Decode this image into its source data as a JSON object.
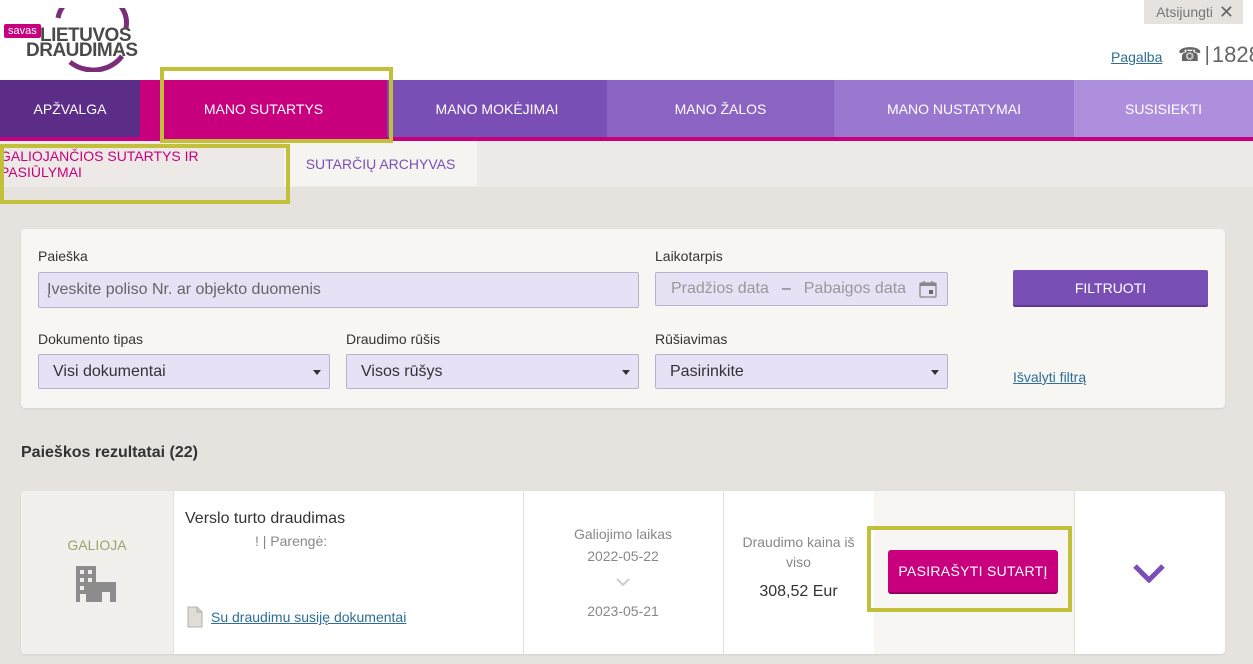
{
  "header": {
    "logo_badge": "savas",
    "logo_line1": "LIETUVOS",
    "logo_line2": "DRAUDIMAS",
    "logout_label": "Atsijungti",
    "help_label": "Pagalba",
    "phone": "1828"
  },
  "nav": {
    "items": [
      {
        "label": "APŽVALGA",
        "color": "#5c2d87"
      },
      {
        "label": "MANO SUTARTYS",
        "color": "#c8007e",
        "active": true
      },
      {
        "label": "MANO MOKĖJIMAI",
        "color": "#7a4fb5"
      },
      {
        "label": "MANO ŽALOS",
        "color": "#8b63c3"
      },
      {
        "label": "MANO NUSTATYMAI",
        "color": "#9a78d0"
      },
      {
        "label": "SUSISIEKTI",
        "color": "#ae8fdd"
      }
    ]
  },
  "subnav": {
    "active": "GALIOJANČIOS SUTARTYS IR PASIŪLYMAI",
    "archive": "SUTARČIŲ ARCHYVAS"
  },
  "filters": {
    "search_label": "Paieška",
    "search_placeholder": "Įveskite poliso Nr. ar objekto duomenis",
    "period_label": "Laikotarpis",
    "period_from": "Pradžios data",
    "period_dash": "–",
    "period_to": "Pabaigos data",
    "filter_button": "FILTRUOTI",
    "doc_type_label": "Dokumento tipas",
    "doc_type_value": "Visi dokumentai",
    "insurance_label": "Draudimo rūšis",
    "insurance_value": "Visos rūšys",
    "sort_label": "Rūšiavimas",
    "sort_value": "Pasirinkite",
    "clear_label": "Išvalyti filtrą"
  },
  "results": {
    "title": "Paieškos rezultatai (22)",
    "items": [
      {
        "status": "GALIOJA",
        "title": "Verslo turto draudimas",
        "meta": "! | Parengė:",
        "docs_link": "Su draudimu susiję dokumentai",
        "validity_label": "Galiojimo laikas",
        "date_from": "2022-05-22",
        "date_to": "2023-05-21",
        "price_label": "Draudimo kaina iš viso",
        "price": "308,52 Eur",
        "action_label": "PASIRAŠYTI SUTARTĮ"
      }
    ]
  },
  "colors": {
    "magenta": "#c8007e",
    "purple": "#7a4fb5",
    "link": "#2d6e96",
    "highlight": "#c2c03b"
  }
}
